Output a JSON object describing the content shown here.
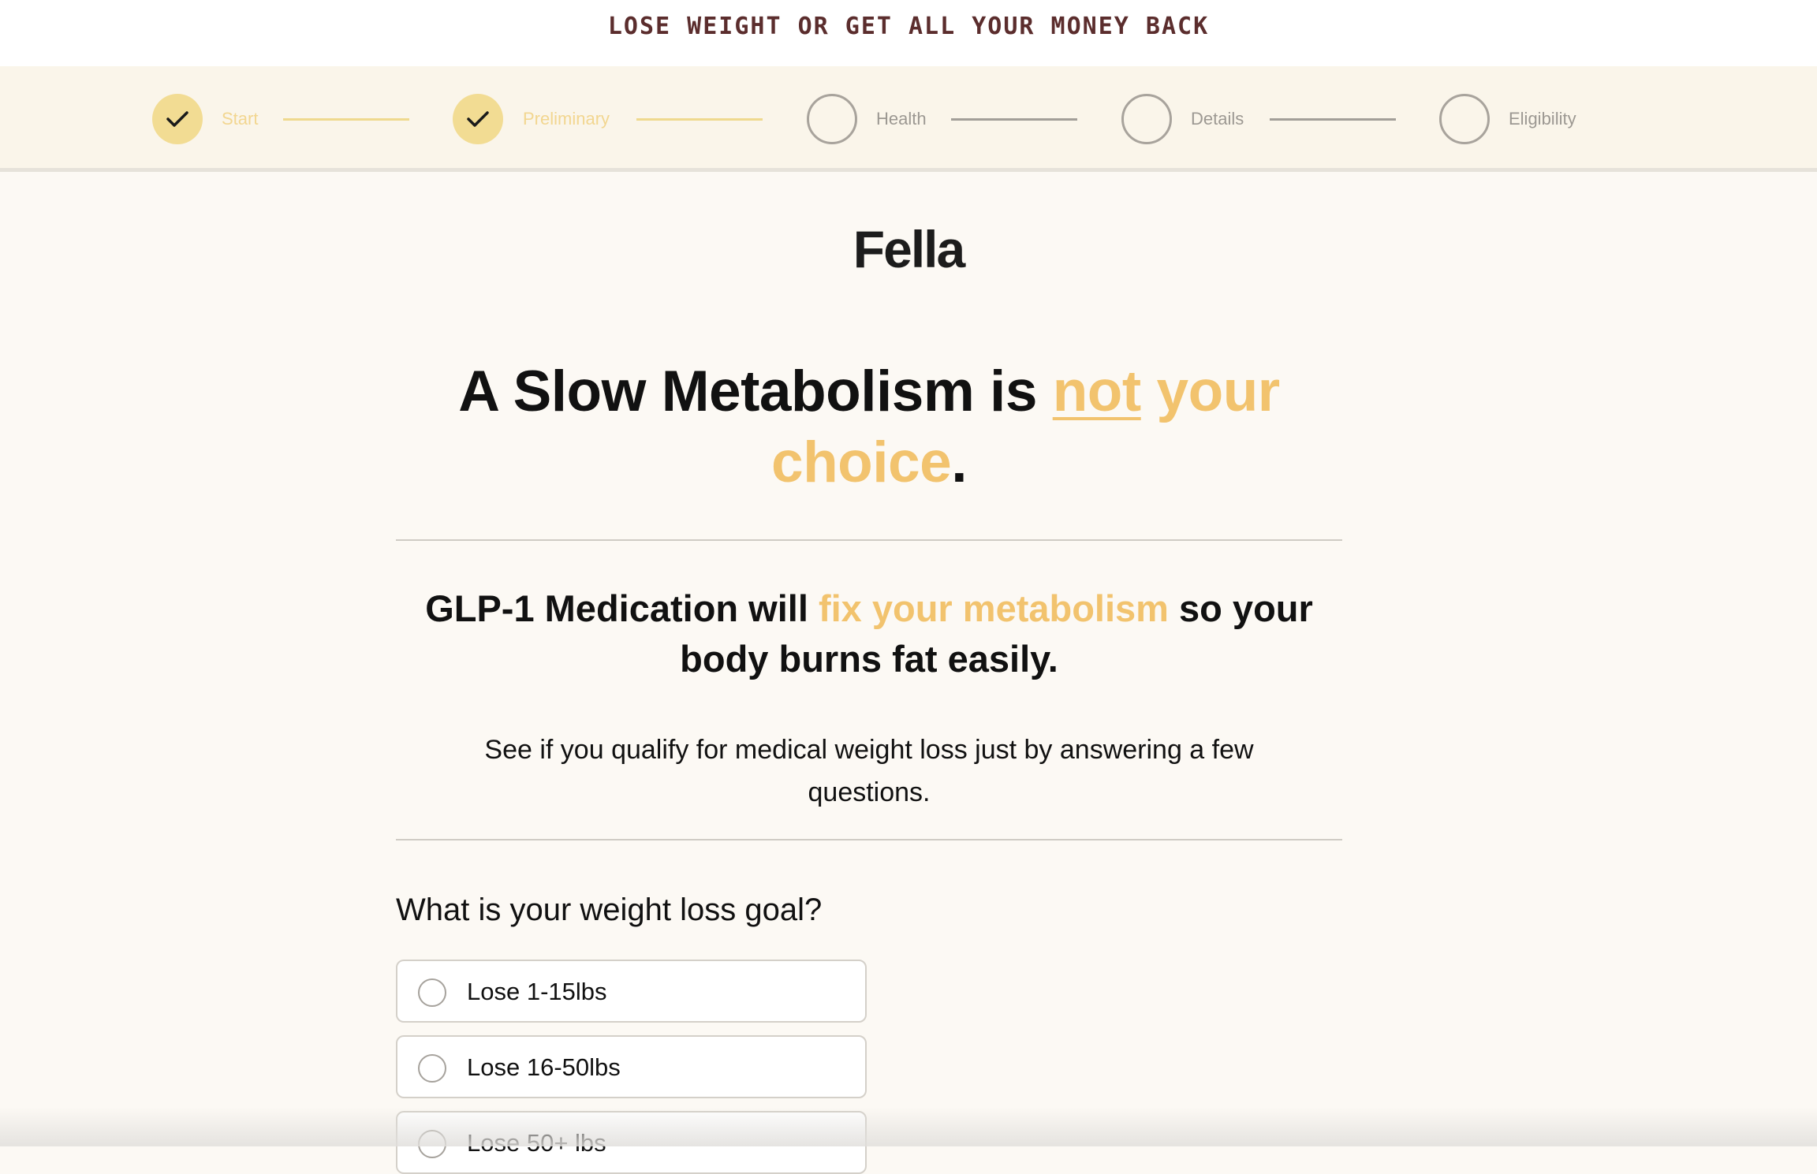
{
  "banner": {
    "text": "LOSE WEIGHT OR GET ALL YOUR MONEY BACK"
  },
  "stepper": {
    "steps": [
      {
        "label": "Start",
        "status": "completed"
      },
      {
        "label": "Preliminary",
        "status": "completed"
      },
      {
        "label": "Health",
        "status": "pending"
      },
      {
        "label": "Details",
        "status": "pending"
      },
      {
        "label": "Eligibility",
        "status": "pending"
      }
    ]
  },
  "brand": {
    "logo": "Fella"
  },
  "hero": {
    "headline_part1": "A Slow Metabolism is ",
    "headline_underlined": "not",
    "headline_accent": " your choice",
    "headline_end": ".",
    "sub_part1": "GLP-1 Medication will ",
    "sub_accent": "fix your metabolism",
    "sub_part2": " so your body burns fat easily.",
    "intro": "See if you qualify for medical weight loss just by answering a few questions."
  },
  "quiz": {
    "question": "What is your weight loss goal?",
    "options": [
      {
        "label": "Lose 1-15lbs"
      },
      {
        "label": "Lose 16-50lbs"
      },
      {
        "label": "Lose 50+ lbs"
      }
    ]
  },
  "colors": {
    "accent": "#F2C36E",
    "step_done": "#F2DC93",
    "banner_text": "#5B2D2D",
    "page_background": "#FCF9F4"
  }
}
